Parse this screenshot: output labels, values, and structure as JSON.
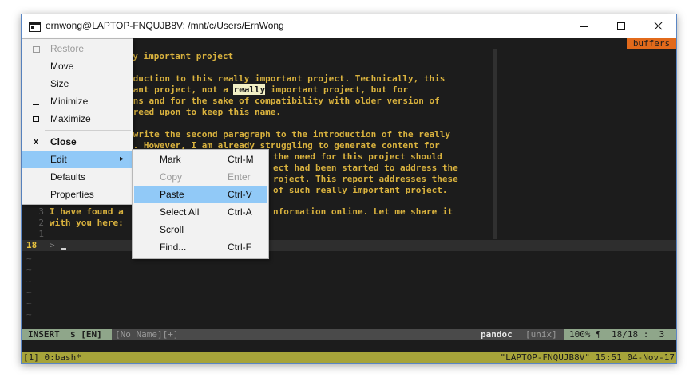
{
  "window": {
    "title": "ernwong@LAPTOP-FNQUJB8V: /mnt/c/Users/ErnWong"
  },
  "editor": {
    "buffers_label": "buffers",
    "lines": [
      "lly important project",
      "",
      "oduction to this really important project. Technically, this",
      "tant project, not a ",
      "really",
      " important project, but for",
      "ons and for the sake of compatibility with older version of",
      "greed upon to keep this name.",
      "",
      " write the second paragraph to the introduction of the really",
      "t. However, I am already struggling to generate content for",
      "the need for this project should",
      "ect had been started to address the",
      "roject. This report addresses these",
      "of such really important project.",
      "I have found a",
      "nformation online. Let me share it",
      "with you here:"
    ],
    "relative_numbers": [
      "3",
      "2",
      "1"
    ],
    "current_line": "18",
    "prompt": ">",
    "tilde": "~"
  },
  "statusline": {
    "mode": "INSERT  $ [EN]",
    "file": "[No Name][+]",
    "filetype": "pandoc",
    "fileformat": "[unix]",
    "position": "100% ¶  18/18 :  3"
  },
  "tmux": {
    "left": "[1] 0:bash*",
    "right": "\"LAPTOP-FNQUJB8V\" 15:51 04-Nov-17"
  },
  "system_menu": {
    "items": [
      {
        "label": "Restore"
      },
      {
        "label": "Move"
      },
      {
        "label": "Size"
      },
      {
        "label": "Minimize"
      },
      {
        "label": "Maximize"
      },
      {
        "label": "Close",
        "icon": "x"
      },
      {
        "label": "Edit"
      },
      {
        "label": "Defaults"
      },
      {
        "label": "Properties"
      }
    ]
  },
  "edit_menu": {
    "items": [
      {
        "label": "Mark",
        "shortcut": "Ctrl-M"
      },
      {
        "label": "Copy",
        "shortcut": "Enter"
      },
      {
        "label": "Paste",
        "shortcut": "Ctrl-V"
      },
      {
        "label": "Select All",
        "shortcut": "Ctrl-A"
      },
      {
        "label": "Scroll",
        "shortcut": ""
      },
      {
        "label": "Find...",
        "shortcut": "Ctrl-F"
      }
    ]
  },
  "colors": {
    "text": "#d9b23e",
    "menu_highlight": "#91c9f7",
    "buffers_tab": "#e26a1b",
    "statusline_green": "#8fa68a",
    "tmux_bar": "#a7a43a",
    "window_border": "#5a86c4"
  }
}
